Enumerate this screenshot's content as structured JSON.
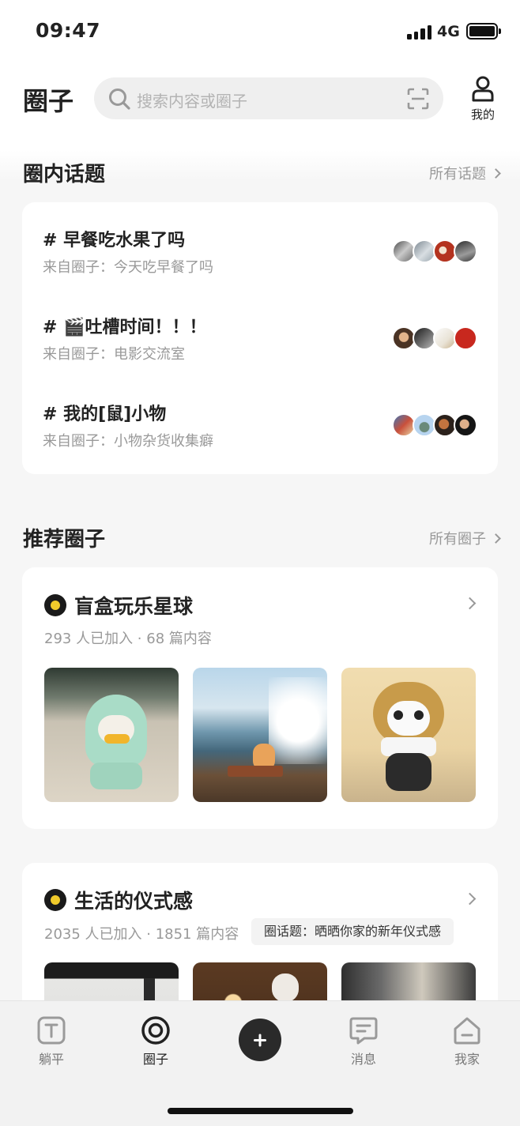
{
  "status_bar": {
    "time": "09:47",
    "network": "4G"
  },
  "header": {
    "title": "圈子",
    "search_placeholder": "搜索内容或圈子",
    "me_label": "我的"
  },
  "topics_section": {
    "title": "圈内话题",
    "all_link": "所有话题",
    "items": [
      {
        "title": "# 早餐吃水果了吗",
        "source": "来自圈子：今天吃早餐了吗"
      },
      {
        "title": "# 🎬吐槽时间！！！",
        "source": "来自圈子：电影交流室"
      },
      {
        "title": "# 我的[鼠]小物",
        "source": "来自圈子：小物杂货收集癖"
      }
    ]
  },
  "circles_section": {
    "title": "推荐圈子",
    "all_link": "所有圈子",
    "items": [
      {
        "name": "盲盒玩乐星球",
        "meta": "293 人已加入 · 68 篇内容"
      },
      {
        "name": "生活的仪式感",
        "meta": "2035 人已加入 · 1851 篇内容",
        "topic_tag": "圈话题：晒晒你家的新年仪式感"
      }
    ]
  },
  "tabbar": {
    "tabs": [
      {
        "label": "躺平"
      },
      {
        "label": "圈子"
      },
      {
        "label": "消息"
      },
      {
        "label": "我家"
      }
    ]
  }
}
